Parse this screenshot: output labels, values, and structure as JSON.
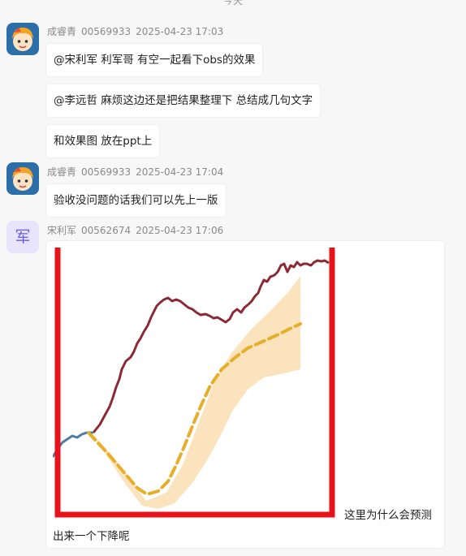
{
  "date_separator": "今天",
  "messages": [
    {
      "sender": "成睿青",
      "id": "00569933",
      "time": "2025-04-23 17:03",
      "bubbles": [
        "@宋利军  利军哥 有空一起看下obs的效果",
        "@李远哲 麻烦这边还是把结果整理下 总结成几句文字",
        "和效果图  放在ppt上"
      ]
    },
    {
      "sender": "成睿青",
      "id": "00569933",
      "time": "2025-04-23 17:04",
      "bubbles": [
        "验收没问题的话我们可以先上一版"
      ]
    },
    {
      "sender": "宋利军",
      "id": "00562674",
      "time": "2025-04-23 17:06",
      "avatar_char": "军",
      "caption_line1": "这里为什么会预测",
      "caption_line2": "出来一个下降呢"
    }
  ],
  "colors": {
    "history_line": "#8b2a35",
    "forecast_line": "#e6ae2a",
    "forecast_band": "#fbe4bd",
    "highlight_box": "#e8121a",
    "start_segment": "#4a7ea8"
  },
  "icons": {
    "avatar_1": "cartoon-avatar-icon",
    "avatar_2": "cartoon-avatar-icon"
  }
}
